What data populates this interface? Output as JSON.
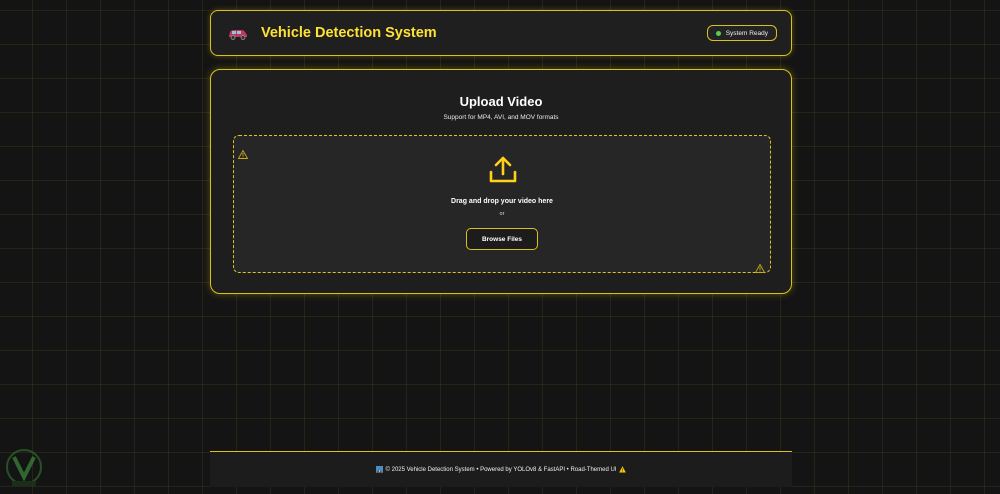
{
  "header": {
    "title": "Vehicle Detection System",
    "status": "System Ready",
    "icon": "car-icon"
  },
  "upload": {
    "title": "Upload Video",
    "subtitle": "Support for MP4, AVI, and MOV formats",
    "drop_text": "Drag and drop your video here",
    "or_text": "or",
    "browse_label": "Browse Files",
    "icon": "upload-icon"
  },
  "footer": {
    "text": "© 2025 Vehicle Detection System • Powered by YOLOv8 & FastAPI • Road-Themed UI"
  },
  "colors": {
    "accent": "#ffe234",
    "border": "#d8c21a",
    "status_ok": "#5ccc50",
    "background": "#141414"
  }
}
